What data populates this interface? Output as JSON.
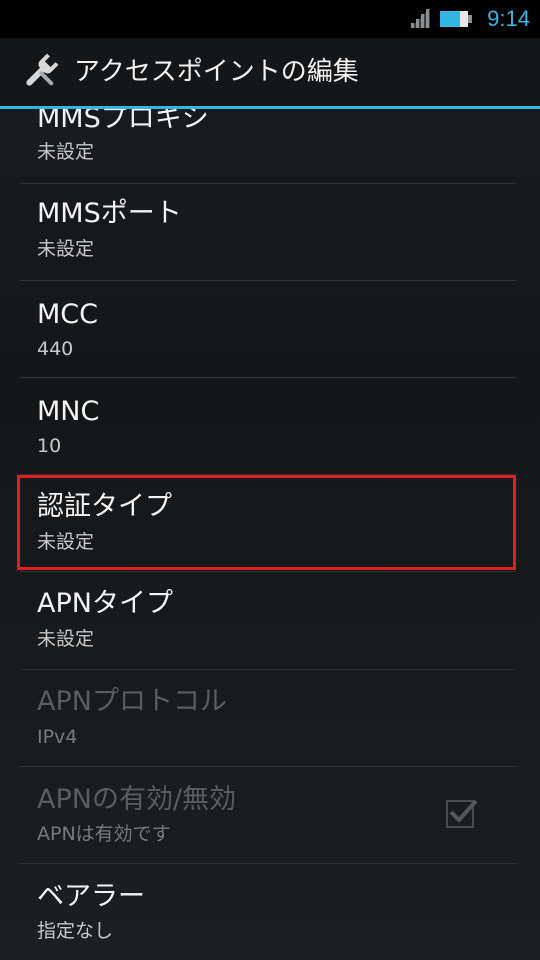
{
  "status_bar": {
    "time": "9:14",
    "signal_icon": "signal-strength-icon",
    "battery_icon": "battery-icon",
    "accent_color": "#33b5e5"
  },
  "action_bar": {
    "title": "アクセスポイントの編集",
    "icon": "wrench-icon"
  },
  "settings": [
    {
      "title": "MMSプロキシ",
      "summary": "未設定",
      "enabled": true
    },
    {
      "title": "MMSポート",
      "summary": "未設定",
      "enabled": true
    },
    {
      "title": "MCC",
      "summary": "440",
      "enabled": true
    },
    {
      "title": "MNC",
      "summary": "10",
      "enabled": true
    },
    {
      "title": "認証タイプ",
      "summary": "未設定",
      "enabled": true,
      "highlighted": true
    },
    {
      "title": "APNタイプ",
      "summary": "未設定",
      "enabled": true
    },
    {
      "title": "APNプロトコル",
      "summary": "IPv4",
      "enabled": false
    },
    {
      "title": "APNの有効/無効",
      "summary": "APNは有効です",
      "enabled": false,
      "checked": true
    },
    {
      "title": "ベアラー",
      "summary": "指定なし",
      "enabled": true
    }
  ],
  "highlight_color": "#e0201f"
}
